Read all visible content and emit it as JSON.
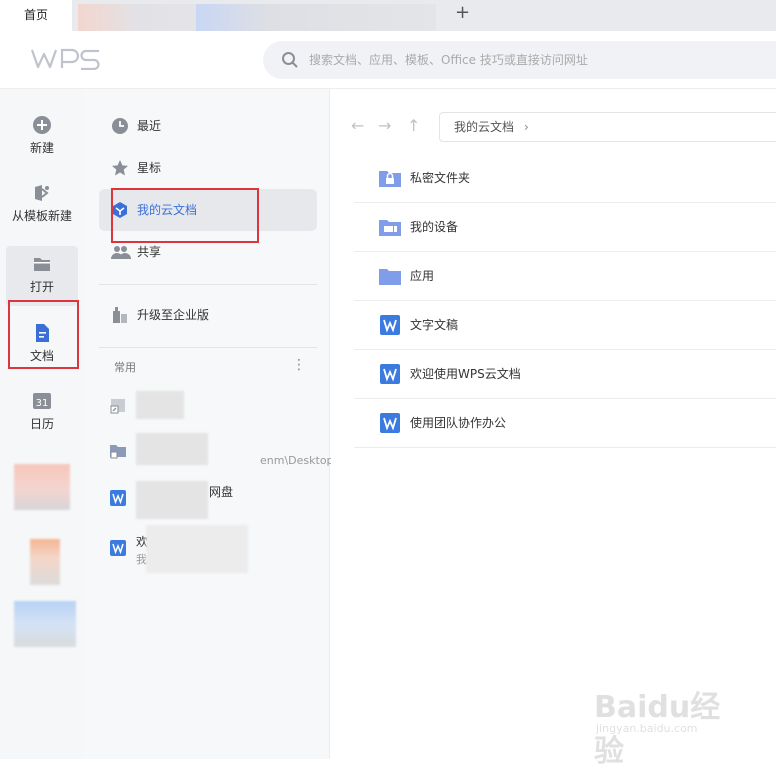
{
  "tabs": {
    "home": "首页"
  },
  "header": {
    "logo_text": "WPS",
    "search_placeholder": "搜索文档、应用、模板、Office 技巧或直接访问网址"
  },
  "rail": {
    "items": [
      {
        "label": "新建",
        "icon": "plus-circle-icon"
      },
      {
        "label": "从模板新建",
        "icon": "template-icon"
      },
      {
        "label": "打开",
        "icon": "folder-open-icon"
      },
      {
        "label": "文档",
        "icon": "document-icon"
      },
      {
        "label": "日历",
        "icon": "calendar-icon"
      }
    ],
    "calendar_day": "31"
  },
  "sidebar": {
    "items": [
      {
        "label": "最近",
        "icon": "clock-icon"
      },
      {
        "label": "星标",
        "icon": "star-icon"
      },
      {
        "label": "我的云文档",
        "icon": "cloud-doc-icon"
      },
      {
        "label": "共享",
        "icon": "share-people-icon"
      },
      {
        "label": "升级至企业版",
        "icon": "enterprise-icon"
      }
    ],
    "section_title": "常用",
    "more": "⋮",
    "frequent": [
      {
        "title": "",
        "subtitle": ""
      },
      {
        "title": "",
        "subtitle": "enm\\Desktop"
      },
      {
        "title": "网盘",
        "subtitle": ""
      },
      {
        "title": "欢",
        "subtitle": "我的云"
      }
    ]
  },
  "main": {
    "breadcrumb": "我的云文档",
    "breadcrumb_chevron": "›",
    "files": [
      {
        "name": "私密文件夹",
        "icon": "private-folder-icon"
      },
      {
        "name": "我的设备",
        "icon": "device-folder-icon"
      },
      {
        "name": "应用",
        "icon": "folder-icon"
      },
      {
        "name": "文字文稿",
        "icon": "wps-writer-icon"
      },
      {
        "name": "欢迎使用WPS云文档",
        "icon": "wps-writer-icon"
      },
      {
        "name": "使用团队协作办公",
        "icon": "wps-writer-icon"
      }
    ]
  },
  "watermark": {
    "brand": "Baidu经验",
    "url": "jingyan.baidu.com"
  },
  "colors": {
    "accent": "#3b6fd8",
    "highlight_box": "#d9363e",
    "folder": "#7f9de8"
  }
}
